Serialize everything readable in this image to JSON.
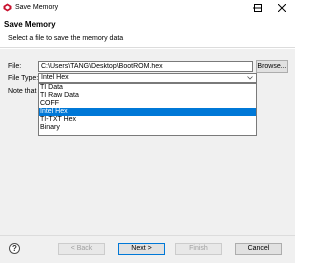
{
  "window": {
    "title": "Save Memory",
    "controls": {
      "minimize": "minimize",
      "maximize": "maximize",
      "close": "close"
    }
  },
  "header": {
    "title": "Save Memory",
    "description": "Select a file to save the memory data"
  },
  "form": {
    "file_label": "File:",
    "file_path": "C:\\Users\\TANG\\Desktop\\BootROM.hex",
    "browse_label": "Browse...",
    "file_type_label": "File Type:",
    "file_type_selected": "Intel Hex",
    "note_label": "Note that",
    "file_type_options": [
      {
        "label": "TI Data",
        "selected": false
      },
      {
        "label": "TI Raw Data",
        "selected": false
      },
      {
        "label": "COFF",
        "selected": false
      },
      {
        "label": "Intel Hex",
        "selected": true
      },
      {
        "label": "TI-TXT Hex",
        "selected": false
      },
      {
        "label": "Binary",
        "selected": false
      }
    ]
  },
  "footer": {
    "help_label": "?",
    "back_label": "< Back",
    "next_label": "Next >",
    "finish_label": "Finish",
    "cancel_label": "Cancel"
  },
  "colors": {
    "selection": "#0078d7",
    "app_icon": "#c8102e",
    "panel_bg": "#f0f0f0"
  }
}
